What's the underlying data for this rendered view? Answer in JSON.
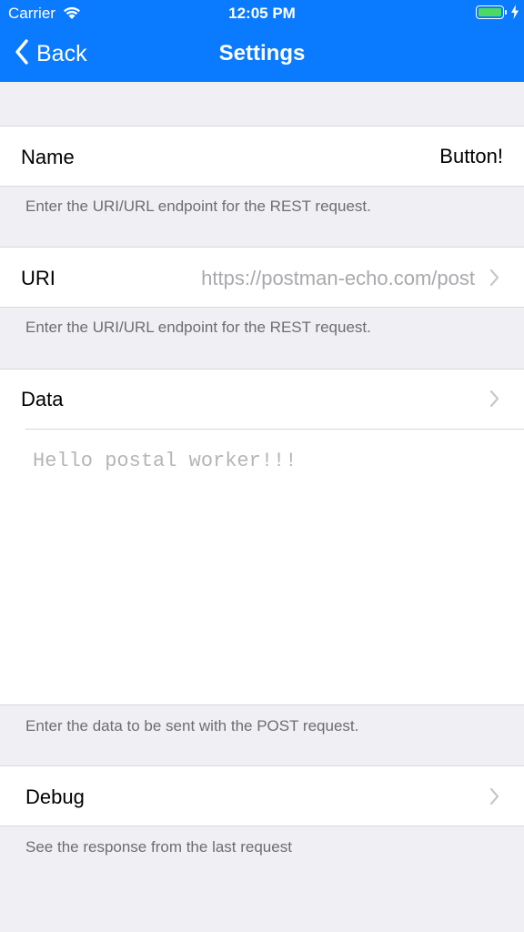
{
  "status_bar": {
    "carrier": "Carrier",
    "time": "12:05 PM",
    "icons": [
      "wifi-icon",
      "battery-icon",
      "charging-bolt-icon"
    ],
    "battery_color": "#4CD964"
  },
  "nav": {
    "back_label": "Back",
    "title": "Settings",
    "background": "#0A7AFF"
  },
  "name_row": {
    "label": "Name",
    "value": "Button!"
  },
  "uri_footer_top": "Enter the URI/URL endpoint for the REST request.",
  "uri_row": {
    "label": "URI",
    "value": "https://postman-echo.com/post"
  },
  "uri_footer": "Enter the URI/URL endpoint for the REST request.",
  "data_row": {
    "label": "Data",
    "placeholder": "Hello postal worker!!!"
  },
  "data_footer": "Enter the data to be sent with the POST request.",
  "debug_row": {
    "label": "Debug"
  },
  "debug_footer": "See the response from the last request"
}
